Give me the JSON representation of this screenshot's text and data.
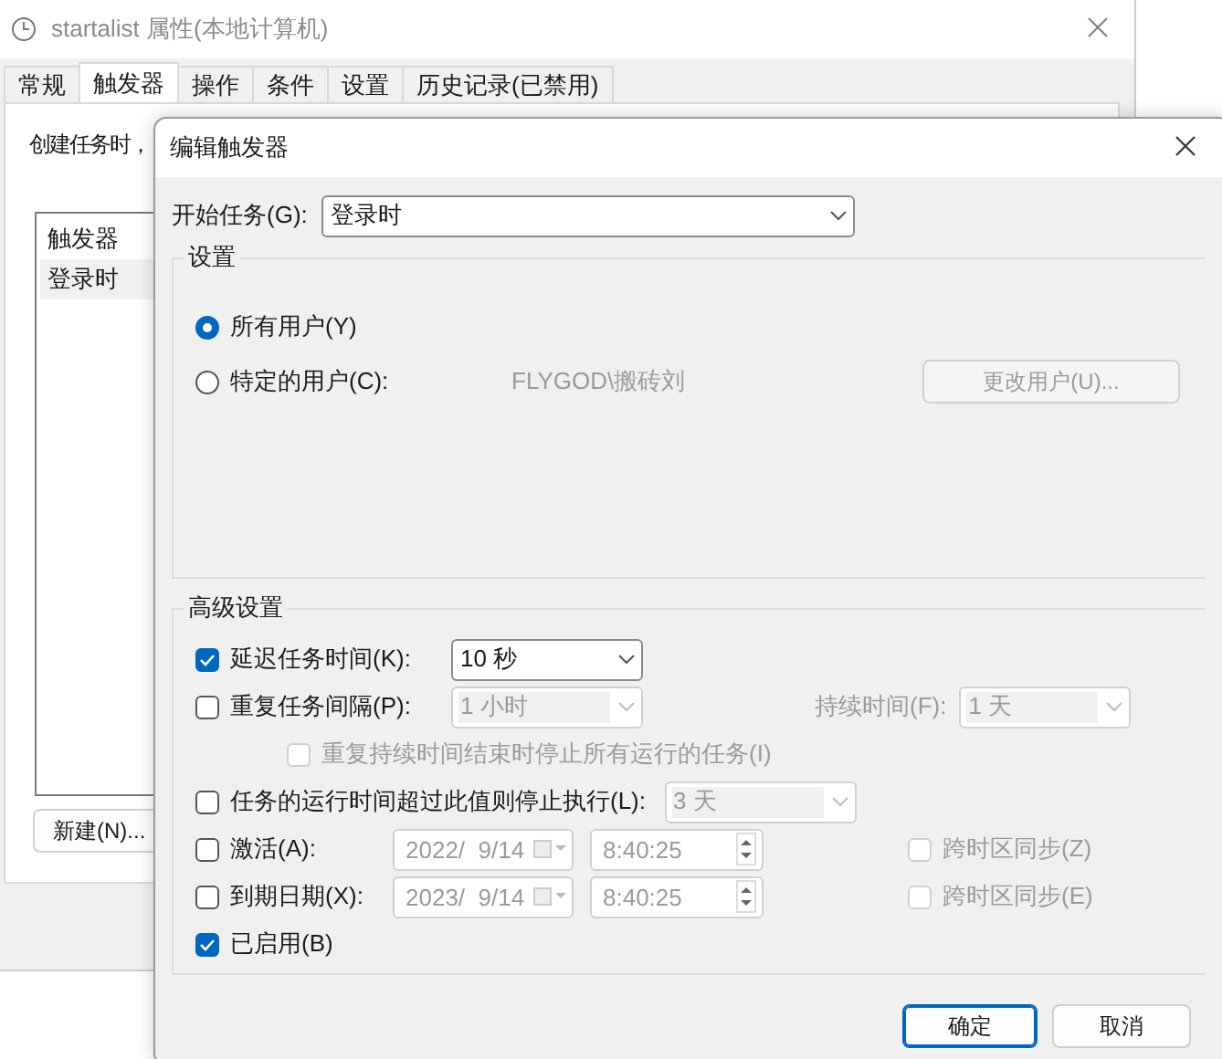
{
  "window": {
    "title": "startalist 属性(本地计算机)"
  },
  "tabs": [
    {
      "label": "常规",
      "selected": false
    },
    {
      "label": "触发器",
      "selected": true
    },
    {
      "label": "操作",
      "selected": false
    },
    {
      "label": "条件",
      "selected": false
    },
    {
      "label": "设置",
      "selected": false
    },
    {
      "label": "历史记录(已禁用)",
      "selected": false
    }
  ],
  "trigger_tab": {
    "description": "创建任务时，",
    "list": {
      "header": "触发器",
      "rows": [
        {
          "text": "登录时",
          "selected": true
        }
      ]
    },
    "new_button": "新建(N)..."
  },
  "dialog": {
    "title": "编辑触发器",
    "begin_task": {
      "label": "开始任务(G):",
      "value": "登录时"
    },
    "settings": {
      "title": "设置",
      "options": [
        {
          "label": "所有用户(Y)",
          "selected": true
        },
        {
          "label": "特定的用户(C):",
          "selected": false
        }
      ],
      "user": "FLYGOD\\搬砖刘",
      "change_user_button": {
        "label": "更改用户(U)...",
        "disabled": true
      }
    },
    "advanced": {
      "title": "高级设置",
      "rows": [
        {
          "kind": "select",
          "label": "延迟任务时间(K):",
          "checked": true,
          "value": "10 秒",
          "disabled": false
        },
        {
          "kind": "select",
          "label": "重复任务间隔(P):",
          "checked": false,
          "value": "1 小时",
          "disabled": true,
          "extra": {
            "label": "持续时间(F):",
            "value": "1 天"
          }
        },
        {
          "kind": "sub",
          "label": "重复持续时间结束时停止所有运行的任务(I)",
          "checked": false,
          "disabled": true
        },
        {
          "kind": "select",
          "label": "任务的运行时间超过此值则停止执行(L):",
          "checked": false,
          "value": "3 天",
          "disabled": true
        },
        {
          "kind": "date",
          "label": "激活(A):",
          "checked": false,
          "date": "2022/  9/14",
          "time": "8:40:25",
          "disabled": true,
          "sync": {
            "label": "跨时区同步(Z)",
            "checked": false
          }
        },
        {
          "kind": "date",
          "label": "到期日期(X):",
          "checked": false,
          "date": "2023/  9/14",
          "time": "8:40:25",
          "disabled": true,
          "sync": {
            "label": "跨时区同步(E)",
            "checked": false
          }
        },
        {
          "kind": "check",
          "label": "已启用(B)",
          "checked": true
        }
      ]
    },
    "buttons": [
      {
        "label": "确定",
        "default": true
      },
      {
        "label": "取消",
        "default": false
      }
    ]
  }
}
